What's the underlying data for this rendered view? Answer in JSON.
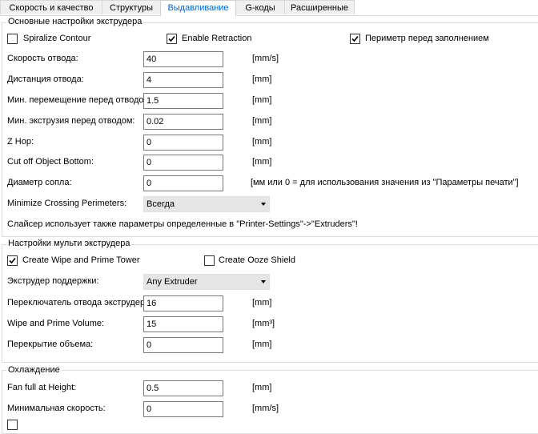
{
  "tabs": [
    {
      "label": "Скорость и качество"
    },
    {
      "label": "Структуры"
    },
    {
      "label": "Выдавливание"
    },
    {
      "label": "G-коды"
    },
    {
      "label": "Расширенные"
    }
  ],
  "extruder_settings": {
    "title": "Основные настройки экструдера",
    "spiralize": {
      "label": "Spiralize Contour",
      "checked": false
    },
    "enable_retraction": {
      "label": "Enable Retraction",
      "checked": true
    },
    "perimeter_first": {
      "label": "Периметр перед заполнением",
      "checked": true
    },
    "retract_speed": {
      "label": "Скорость отвода:",
      "value": "40",
      "unit": "[mm/s]"
    },
    "retract_distance": {
      "label": "Дистанция отвода:",
      "value": "4",
      "unit": "[mm]"
    },
    "min_travel": {
      "label": "Мин. перемещение перед отводом:",
      "value": "1.5",
      "unit": "[mm]"
    },
    "min_extrusion": {
      "label": "Мин. экструзия перед отводом:",
      "value": "0.02",
      "unit": "[mm]"
    },
    "z_hop": {
      "label": "Z Hop:",
      "value": "0",
      "unit": "[mm]"
    },
    "cut_off": {
      "label": "Cut off Object Bottom:",
      "value": "0",
      "unit": "[mm]"
    },
    "nozzle_diameter": {
      "label": "Диаметр сопла:",
      "value": "0",
      "unit": "[мм или 0 = для использования значения из \"Параметры печати\"]"
    },
    "minimize_crossing": {
      "label": "Minimize Crossing Perimeters:",
      "selected": "Всегда"
    },
    "note": "Слайсер использует также параметры определенные в \"Printer-Settings\"->\"Extruders\"!"
  },
  "multi_extruder": {
    "title": "Настройки мульти экструдера",
    "wipe_tower": {
      "label": "Create Wipe and Prime Tower",
      "checked": true
    },
    "ooze_shield": {
      "label": "Create Ooze Shield",
      "checked": false
    },
    "support_extruder": {
      "label": "Экструдер поддержки:",
      "selected": "Any Extruder"
    },
    "switch_retract": {
      "label": "Переключатель отвода экструдера:",
      "value": "16",
      "unit": "[mm]"
    },
    "wipe_volume": {
      "label": "Wipe and Prime Volume:",
      "value": "15",
      "unit": "[mm³]"
    },
    "overlap_volume": {
      "label": "Перекрытие объема:",
      "value": "0",
      "unit": "[mm]"
    }
  },
  "cooling": {
    "title": "Охлаждение",
    "fan_full_height": {
      "label": "Fan full at Height:",
      "value": "0.5",
      "unit": "[mm]"
    },
    "min_speed": {
      "label": "Минимальная скорость:",
      "value": "0",
      "unit": "[mm/s]"
    }
  },
  "colors": {
    "active_tab_text": "#0066cc",
    "dropdown_bg": "#e5e5e5",
    "group_border": "#dcdcdc"
  }
}
